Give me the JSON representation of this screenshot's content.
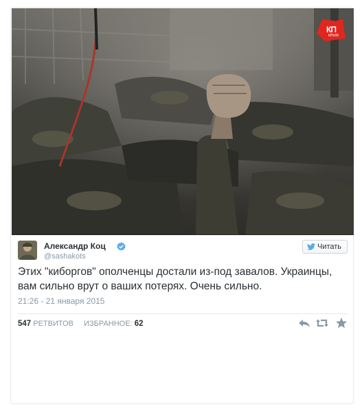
{
  "photo": {
    "alt_brand": "КП",
    "brand_sub": "КРЫМ",
    "brand_color": "#e0261f"
  },
  "tweet": {
    "author_name": "Александр Коц",
    "author_handle": "@sashakots",
    "verified": true,
    "follow_label": "Читать",
    "text": "Этих \"киборгов\" ополченцы достали из-под завалов. Украинцы, вам сильно врут о ваших потерях. Очень сильно.",
    "timestamp": "21:26 - 21 января 2015",
    "retweets_count": "547",
    "retweets_label": "РЕТВИТОВ",
    "favorites_label": "ИЗБРАННОЕ:",
    "favorites_count": "62"
  },
  "actions": [
    "reply-icon",
    "retweet-icon",
    "favorite-icon"
  ],
  "colors": {
    "twitter_blue": "#55acee",
    "text": "#292f33",
    "muted": "#8899a6",
    "border": "#e1e8ed"
  }
}
